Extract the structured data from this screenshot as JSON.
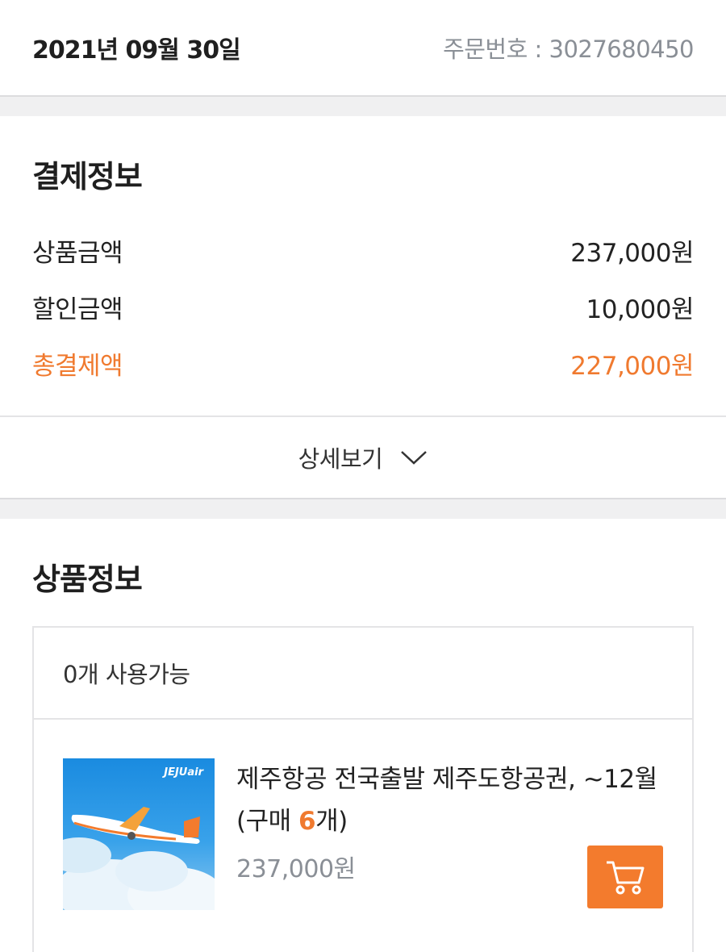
{
  "header": {
    "date": "2021년 09월 30일",
    "order_number": "주문번호 : 3027680450"
  },
  "payment": {
    "title": "결제정보",
    "rows": [
      {
        "label": "상품금액",
        "value": "237,000원"
      },
      {
        "label": "할인금액",
        "value": "10,000원"
      }
    ],
    "total": {
      "label": "총결제액",
      "value": "227,000원"
    },
    "detail_label": "상세보기"
  },
  "product": {
    "title": "상품정보",
    "availability": "0개 사용가능",
    "item": {
      "name": "제주항공 전국출발 제주도항공권, ~12월",
      "purchase_prefix": "(구매 ",
      "purchase_qty": "6",
      "purchase_suffix": "개)",
      "price": "237,000원",
      "image_brand": "JEJUair"
    }
  },
  "colors": {
    "accent": "#f07a2f",
    "muted_text": "#8a8f96"
  },
  "icons": {
    "detail": "chevron-down-icon",
    "cart": "cart-icon"
  }
}
